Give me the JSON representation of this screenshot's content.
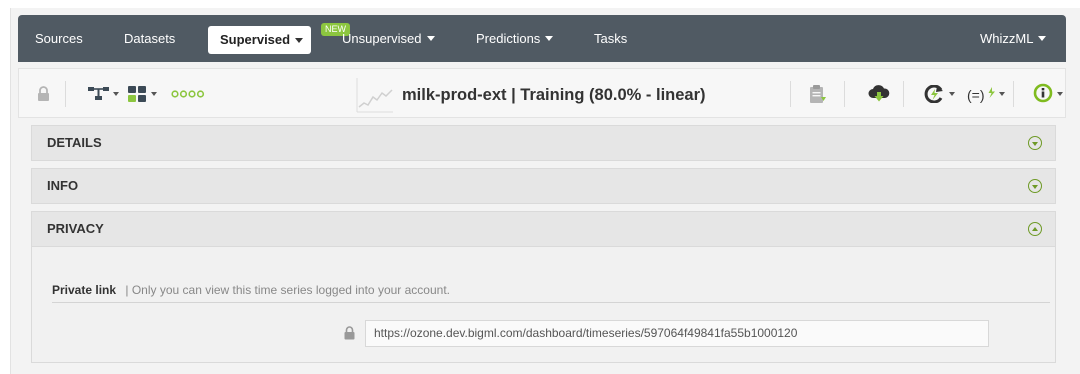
{
  "nav": {
    "items": [
      {
        "label": "Sources",
        "has_caret": false
      },
      {
        "label": "Datasets",
        "has_caret": false
      },
      {
        "label": "Supervised",
        "has_caret": true,
        "active": true,
        "badge": "NEW"
      },
      {
        "label": "Unsupervised",
        "has_caret": true
      },
      {
        "label": "Predictions",
        "has_caret": true
      },
      {
        "label": "Tasks",
        "has_caret": false
      }
    ],
    "right_menu": {
      "label": "WhizzML",
      "has_caret": true
    }
  },
  "toolbar": {
    "title": "milk-prod-ext | Training (80.0% - linear)",
    "icons": [
      "lock-icon",
      "model-tree-icon",
      "dataset-icon",
      "more-dots-icon",
      "sparkline-icon",
      "report-download-icon",
      "cloud-download-icon",
      "retrain-icon",
      "formula-icon",
      "info-icon"
    ]
  },
  "panels": [
    {
      "label": "DETAILS",
      "expanded": false
    },
    {
      "label": "INFO",
      "expanded": false
    },
    {
      "label": "PRIVACY",
      "expanded": true
    }
  ],
  "privacy": {
    "label": "Private link",
    "description": "| Only you can view this time series logged into your account.",
    "link": "https://ozone.dev.bigml.com/dashboard/timeseries/597064f49841fa55b1000120"
  },
  "colors": {
    "nav_bg": "#505a63",
    "accent_green": "#8cc63f",
    "toggle_green": "#6e9a26",
    "panel_bg": "#e6e6e6"
  }
}
